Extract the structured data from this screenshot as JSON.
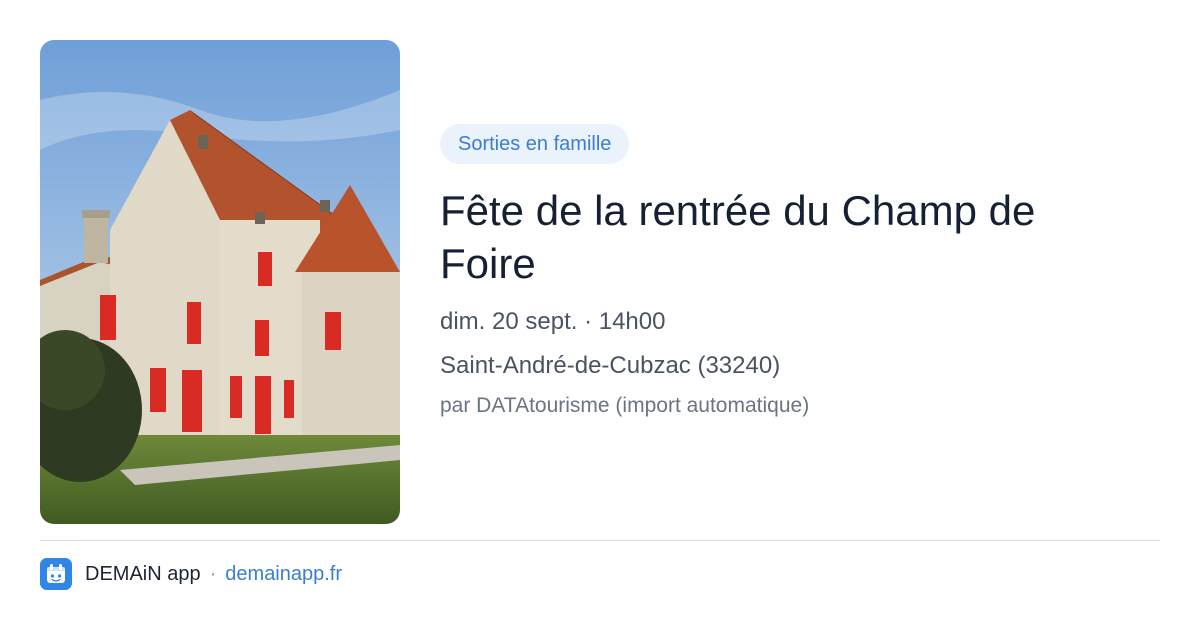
{
  "event": {
    "image": "photo-chateau",
    "category": "Sorties en famille",
    "title": "Fête de la rentrée du Champ de Foire",
    "datetime": "dim. 20 sept. · 14h00",
    "location": "Saint-André-de-Cubzac (33240)",
    "source": "par DATAtourisme (import automatique)"
  },
  "footer": {
    "logo_icon": "demain-app-logo-icon",
    "app_name": "DEMAiN app",
    "separator": "·",
    "domain": "demainapp.fr"
  },
  "colors": {
    "accent": "#3b7dd0",
    "pill_background": "#eaf2fc",
    "title": "#152033",
    "meta": "#4a5362"
  }
}
